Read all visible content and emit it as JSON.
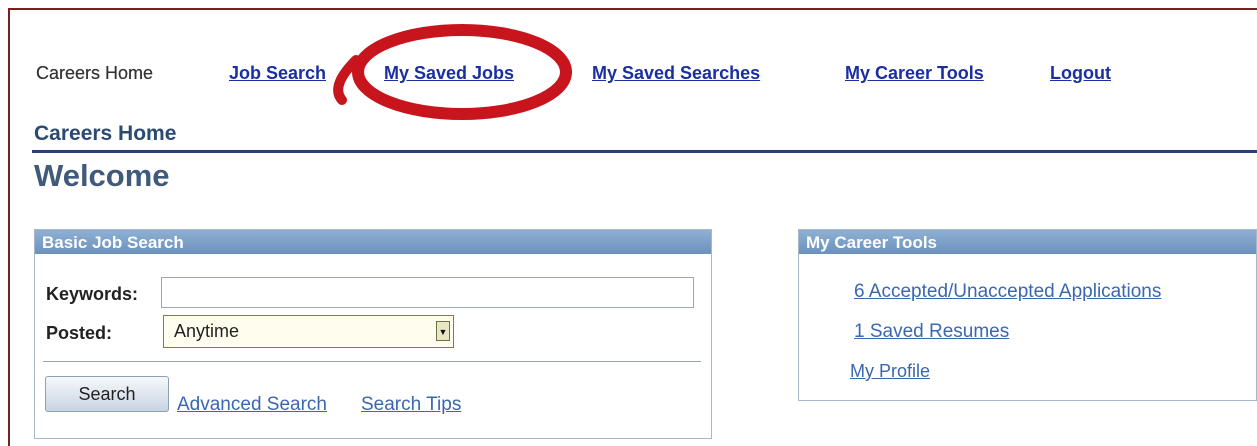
{
  "nav": {
    "home": "Careers Home",
    "job_search": "Job Search",
    "saved_jobs": "My Saved Jobs",
    "saved_searches": "My Saved Searches",
    "career_tools": "My Career Tools",
    "logout": "Logout"
  },
  "breadcrumb": "Careers Home",
  "page_title": "Welcome",
  "search_panel": {
    "title": "Basic Job Search",
    "keywords_label": "Keywords:",
    "keywords_value": "",
    "posted_label": "Posted:",
    "posted_value": "Anytime",
    "search_button": "Search",
    "advanced_link": "Advanced Search",
    "tips_link": "Search Tips"
  },
  "tools_panel": {
    "title": "My Career Tools",
    "links": [
      "6 Accepted/Unaccepted Applications",
      "1 Saved Resumes",
      "My Profile"
    ]
  },
  "colors": {
    "frame": "#7a1f1f",
    "link": "#1a2fa0",
    "heading": "#2b4a72",
    "panel_header": "#7a9ec7",
    "annotation_ring": "#c8141c"
  }
}
